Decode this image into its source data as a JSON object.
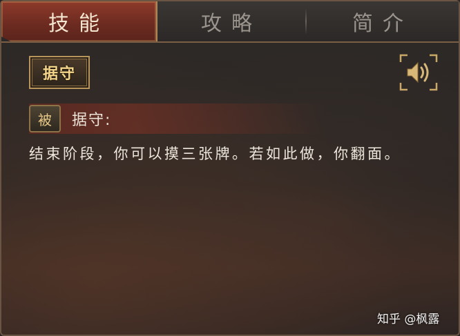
{
  "tabs": [
    {
      "label": "技能"
    },
    {
      "label": "攻略"
    },
    {
      "label": "简介"
    }
  ],
  "skill": {
    "badge": "据守",
    "type_tag": "被",
    "title": "据守:",
    "description": "结束阶段，你可以摸三张牌。若如此做，你翻面。"
  },
  "controls": {
    "speaker_icon": "speaker-icon"
  },
  "watermark": "知乎 @枫露",
  "colors": {
    "active_tab": "#8e3a2a",
    "badge_gold": "#f5d58a",
    "border": "#b8955a"
  }
}
